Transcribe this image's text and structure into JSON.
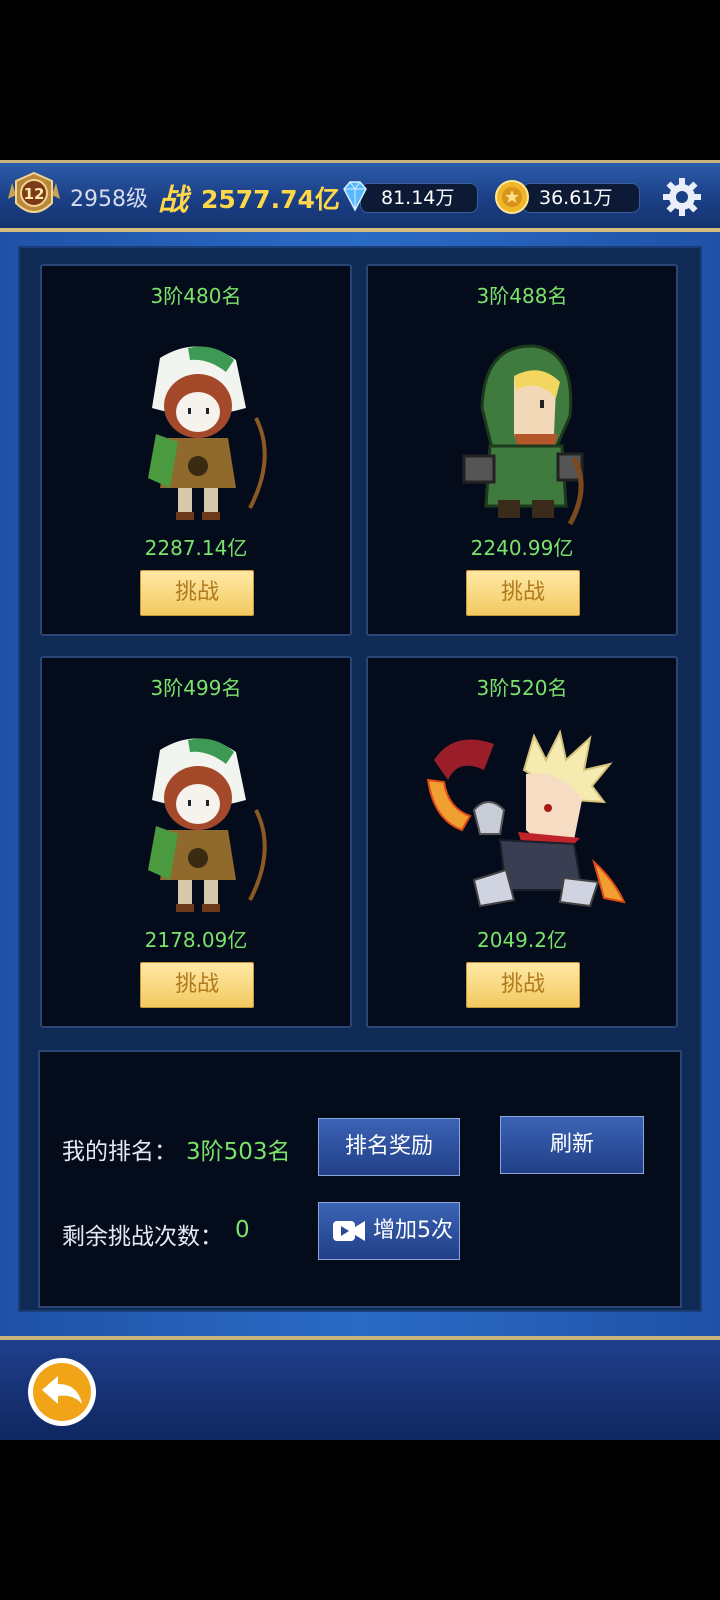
{
  "hud": {
    "level_badge": "12",
    "level": "2958级",
    "battle_label": "战",
    "battle_power": "2577.74亿",
    "diamonds": "81.14万",
    "gold": "36.61万"
  },
  "opponents": [
    {
      "rank": "3阶480名",
      "power": "2287.14亿",
      "button": "挑战",
      "hero": "green-hood-archer-girl"
    },
    {
      "rank": "3阶488名",
      "power": "2240.99亿",
      "button": "挑战",
      "hero": "hooded-ranger-boy"
    },
    {
      "rank": "3阶499名",
      "power": "2178.09亿",
      "button": "挑战",
      "hero": "green-hood-archer-girl"
    },
    {
      "rank": "3阶520名",
      "power": "2049.2亿",
      "button": "挑战",
      "hero": "spiky-hair-blade-warrior"
    }
  ],
  "my_info": {
    "rank_label": "我的排名：",
    "rank_value": "3阶503名",
    "challenges_label": "剩余挑战次数：",
    "challenges_value": "0",
    "reward_button": "排名奖励",
    "refresh_button": "刷新",
    "add_button": "增加5次"
  },
  "colors": {
    "accent_green": "#7be26a",
    "gold_text": "#ffd84a"
  }
}
